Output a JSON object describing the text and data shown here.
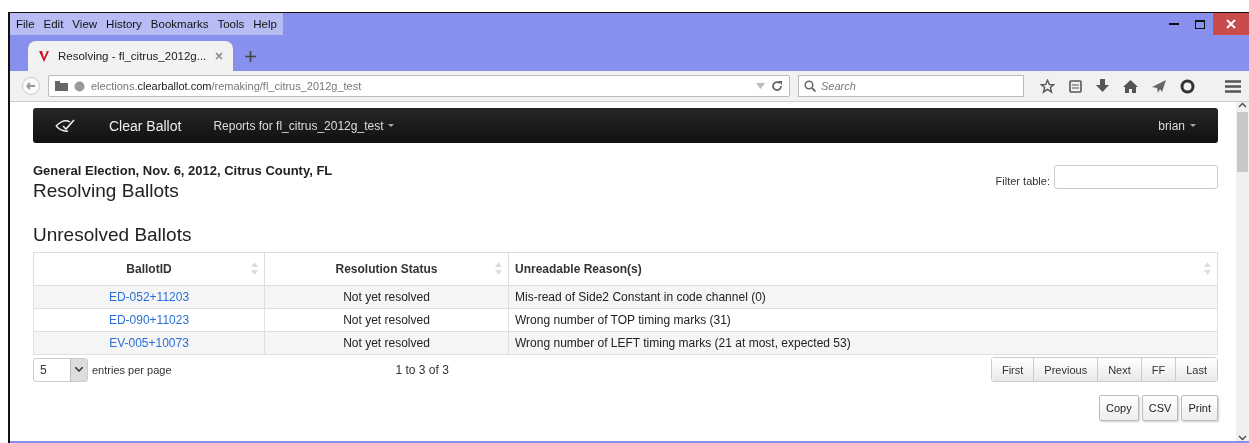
{
  "browser": {
    "menu": [
      "File",
      "Edit",
      "View",
      "History",
      "Bookmarks",
      "Tools",
      "Help"
    ],
    "tab": {
      "title": "Resolving - fl_citrus_2012g..."
    },
    "url": "elections.**clearballot.com**/remaking/fl_citrus_2012g_test",
    "search": {
      "placeholder": "Search"
    }
  },
  "navbar": {
    "brand": "Clear Ballot",
    "menu": "Reports for fl_citrus_2012g_test",
    "user": "brian"
  },
  "page": {
    "subtitle": "General Election, Nov. 6, 2012, Citrus County, FL",
    "title": "Resolving Ballots",
    "filter": {
      "label": "Filter table:"
    },
    "section": "Unresolved Ballots"
  },
  "table": {
    "columns": [
      {
        "label": "BallotID",
        "sortable": true
      },
      {
        "label": "Resolution Status",
        "sortable": true
      },
      {
        "label": "Unreadable Reason(s)",
        "sortable": true
      }
    ],
    "rows": [
      {
        "id": "ED-052+11203",
        "status": "Not yet resolved",
        "reason": "Mis-read of Side2 Constant in code channel (0)"
      },
      {
        "id": "ED-090+11023",
        "status": "Not yet resolved",
        "reason": "Wrong number of TOP timing marks (31)"
      },
      {
        "id": "EV-005+10073",
        "status": "Not yet resolved",
        "reason": "Wrong number of LEFT timing marks (21 at most, expected 53)"
      }
    ]
  },
  "footer": {
    "page_size": "5",
    "page_size_label": "entries per page",
    "info": "1 to 3 of 3",
    "pager": [
      "First",
      "Previous",
      "Next",
      "FF",
      "Last"
    ],
    "export": [
      "Copy",
      "CSV",
      "Print"
    ]
  }
}
